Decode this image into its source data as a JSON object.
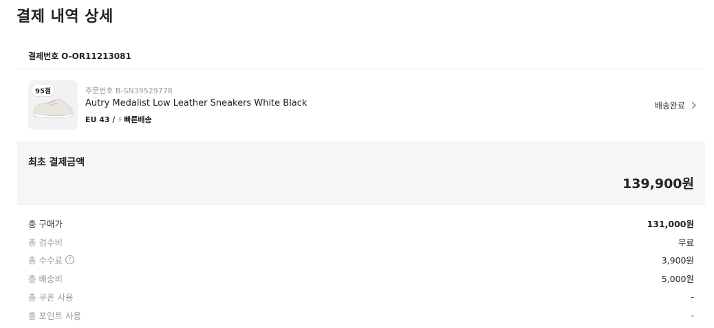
{
  "page_title": "결제 내역 상세",
  "payment": {
    "label": "결제번호",
    "number": "O-OR11213081"
  },
  "product": {
    "score_badge": "95점",
    "order_label": "주문번호 B-SN39529778",
    "name": "Autry Medalist Low Leather Sneakers White Black",
    "size": "EU 43 /",
    "delivery_type": "빠른배송",
    "status": "배송완료"
  },
  "summary": {
    "label": "최초 결제금액",
    "amount": "139,900원"
  },
  "rows": [
    {
      "label": "총 구매가",
      "value": "131,000원"
    },
    {
      "label": "총 검수비",
      "value": "무료"
    },
    {
      "label": "총 수수료",
      "value": "3,900원",
      "help_icon": "?"
    },
    {
      "label": "총 배송비",
      "value": "5,000원"
    },
    {
      "label": "총 쿠폰 사용",
      "value": "-"
    },
    {
      "label": "총 포인트 사용",
      "value": "-"
    }
  ],
  "colors": {
    "accent_green": "#31b46e",
    "panel_bg": "#f6f6f6"
  }
}
